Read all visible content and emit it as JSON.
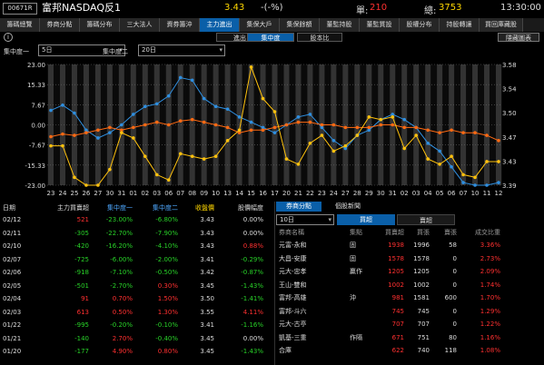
{
  "header": {
    "code": "00671R",
    "title": "富邦NASDAQ反1",
    "price": "3.43",
    "change": "-(-%)",
    "volume_label": "單:",
    "volume": "210",
    "total_label": "總:",
    "total": "3753",
    "time": "13:30:00"
  },
  "tabs": [
    "籌碼總覽",
    "券商分點",
    "籌碼分布",
    "三大法人",
    "資券籌沖",
    "主力進出",
    "集保大戶",
    "集保餘額",
    "董監持股",
    "董監質設",
    "股權分布",
    "持股轉讓",
    "買回庫藏股"
  ],
  "active_tab": 5,
  "subtabs": [
    "進出",
    "集中度",
    "股本比"
  ],
  "active_subtab": 1,
  "hide_button": "隱藏圖表",
  "selector1_label": "集中度一",
  "selector1_value": "5日",
  "selector2_label": "集中度二",
  "selector2_value": "20日",
  "colors": {
    "orange": "#ff6a13",
    "blue": "#2f8fe0",
    "yellow": "#ffc20e",
    "bar": "#555555"
  },
  "chart_data": {
    "type": "line",
    "x": [
      "23",
      "24",
      "25",
      "26",
      "27",
      "30",
      "31",
      "01",
      "02",
      "03",
      "06",
      "07",
      "08",
      "09",
      "10",
      "13",
      "14",
      "15",
      "16",
      "17",
      "20",
      "21",
      "22",
      "23",
      "24",
      "27",
      "28",
      "29",
      "30",
      "31",
      "02",
      "03",
      "04",
      "05",
      "06",
      "07",
      "10",
      "11",
      "12"
    ],
    "left_axis": {
      "ticks": [
        "23.00",
        "15.33",
        "7.67",
        "0.00",
        "-7.67",
        "-15.33",
        "-23.00"
      ],
      "ylim": [
        -23,
        23
      ]
    },
    "right_axis": {
      "ticks": [
        "3.58",
        "3.54",
        "3.50",
        "3.47",
        "3.43",
        "3.39"
      ],
      "ylim": [
        3.39,
        3.58
      ]
    },
    "series": [
      {
        "values": [
          5.5,
          7.5,
          4.5,
          -2,
          -5,
          -3,
          0,
          4,
          7,
          8,
          11,
          18,
          17,
          10,
          7,
          6,
          3,
          1,
          -1,
          -3,
          0,
          3,
          4,
          -1,
          -6,
          -9,
          -4,
          -2,
          2,
          4,
          2,
          -1,
          -7,
          -10,
          -16,
          -22,
          -23,
          -23,
          -22
        ]
      },
      {
        "values": [
          -4.5,
          -3.5,
          -4,
          -3,
          -2,
          -1,
          -2,
          -1,
          0,
          1,
          0,
          1.5,
          2,
          1,
          0,
          -1,
          -3,
          -2,
          -2,
          -1,
          0,
          1,
          1,
          0,
          0,
          -1,
          -1,
          -1,
          0,
          0,
          -1,
          -1,
          -2,
          -3,
          -2,
          -3,
          -3,
          -4,
          -6
        ]
      },
      {
        "values": [
          -8,
          -8,
          -20,
          -23,
          -23,
          -17,
          -3,
          -5,
          -12,
          -19,
          -21,
          -11,
          -12,
          -13,
          -12,
          -6,
          -2,
          22,
          10,
          5,
          -13,
          -15,
          -7,
          -4,
          -10,
          -8,
          -4,
          3,
          2,
          3,
          -9,
          -4,
          -13,
          -15,
          -12,
          -19,
          -20,
          -14,
          -14
        ]
      }
    ]
  },
  "left_table": {
    "headers": [
      "日期",
      "主力買賣超",
      "集中度一",
      "集中度二",
      "收盤價",
      "股價幅度"
    ],
    "rows": [
      [
        "02/12",
        "521",
        "-23.00%",
        "-6.80%",
        "3.43",
        "0.00%"
      ],
      [
        "02/11",
        "-305",
        "-22.70%",
        "-7.90%",
        "3.43",
        "0.00%"
      ],
      [
        "02/10",
        "-420",
        "-16.20%",
        "-4.10%",
        "3.43",
        "0.88%"
      ],
      [
        "02/07",
        "-725",
        "-6.00%",
        "-2.00%",
        "3.41",
        "-0.29%"
      ],
      [
        "02/06",
        "-918",
        "-7.10%",
        "-0.50%",
        "3.42",
        "-0.87%"
      ],
      [
        "02/05",
        "-501",
        "-2.70%",
        "0.30%",
        "3.45",
        "-1.43%"
      ],
      [
        "02/04",
        "91",
        "0.70%",
        "1.50%",
        "3.50",
        "-1.41%"
      ],
      [
        "02/03",
        "613",
        "0.50%",
        "1.30%",
        "3.55",
        "4.11%"
      ],
      [
        "01/22",
        "-995",
        "-0.20%",
        "-0.10%",
        "3.41",
        "-1.16%"
      ],
      [
        "01/21",
        "-140",
        "2.70%",
        "-0.40%",
        "3.45",
        "0.00%"
      ],
      [
        "01/20",
        "-177",
        "4.90%",
        "0.80%",
        "3.45",
        "-1.43%"
      ]
    ]
  },
  "right_panel": {
    "tabs": [
      "券商分點",
      "個股新聞"
    ],
    "range": "10日",
    "buy_label": "買超",
    "sell_label": "賣超",
    "headers": [
      "券商名稱",
      "集點",
      "買賣超",
      "買張",
      "賣張",
      "成交比重"
    ],
    "rows": [
      [
        "元富-永和",
        "固",
        "1938",
        "1996",
        "58",
        "3.36%"
      ],
      [
        "大昌-安康",
        "固",
        "1578",
        "1578",
        "0",
        "2.73%"
      ],
      [
        "元大-忠孝",
        "贏作",
        "1205",
        "1205",
        "0",
        "2.09%"
      ],
      [
        "王山-雙和",
        "",
        "1002",
        "1002",
        "0",
        "1.74%"
      ],
      [
        "富邦-高雄",
        "沖",
        "981",
        "1581",
        "600",
        "1.70%"
      ],
      [
        "富邦-斗六",
        "",
        "745",
        "745",
        "0",
        "1.29%"
      ],
      [
        "元大-古亭",
        "",
        "707",
        "707",
        "0",
        "1.22%"
      ],
      [
        "凱基-三重",
        "作隔",
        "671",
        "751",
        "80",
        "1.16%"
      ],
      [
        "合庫",
        "",
        "622",
        "740",
        "118",
        "1.08%"
      ]
    ]
  }
}
